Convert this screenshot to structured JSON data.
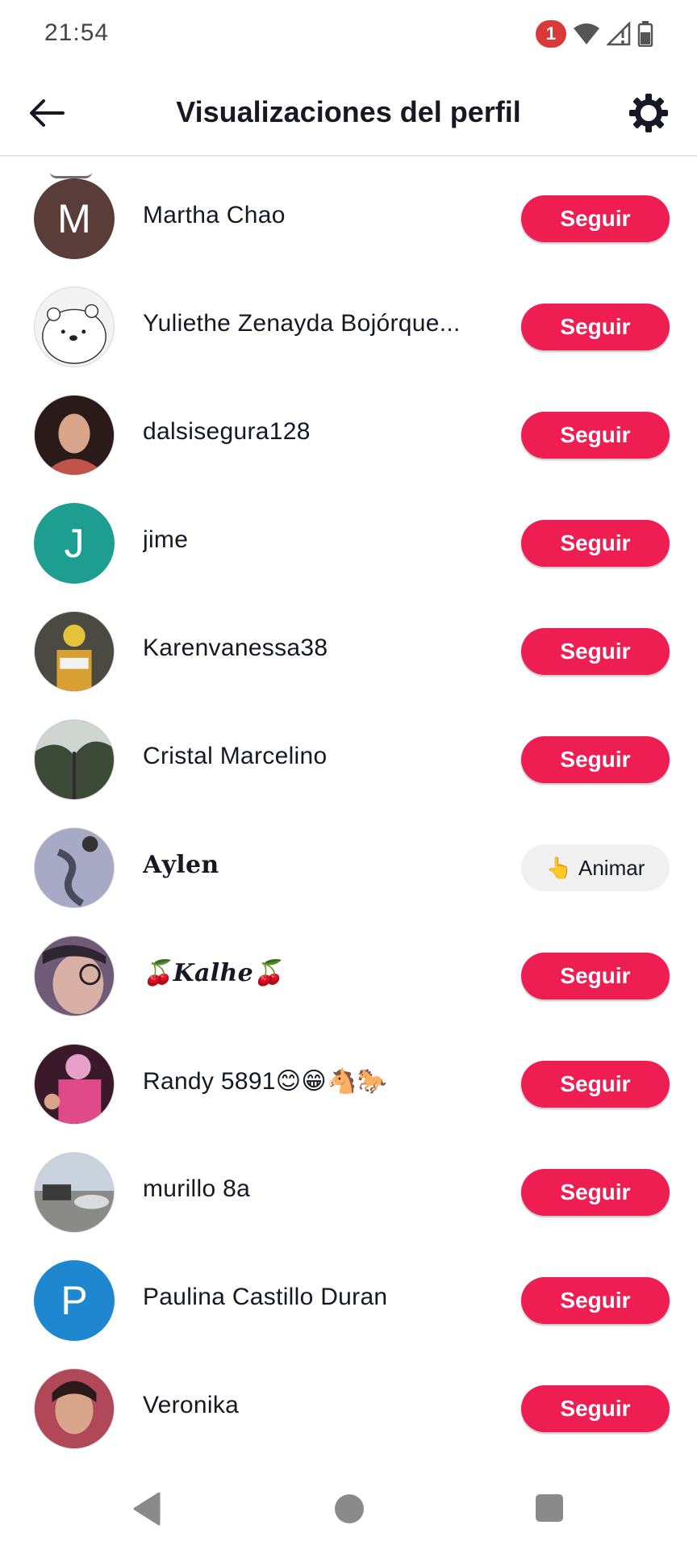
{
  "status_bar": {
    "time": "21:54",
    "notification_count": "1",
    "icons": [
      "wifi-icon",
      "signal-icon",
      "battery-icon"
    ]
  },
  "header": {
    "title": "Visualizaciones del perfil",
    "back_icon": "arrow-left-icon",
    "settings_icon": "gear-icon"
  },
  "colors": {
    "accent": "#ee1d52",
    "cheer_bg": "#f1f1f2"
  },
  "rows": [
    {
      "name": "Martha Chao",
      "avatar_letter": "M",
      "avatar_color": "#5a3c39",
      "action": "Seguir"
    },
    {
      "name": "Yuliethe Zenayda Bojórque...",
      "avatar_letter": "",
      "avatar_color": "#f3f3f3",
      "action": "Seguir"
    },
    {
      "name": "dalsisegura128",
      "avatar_letter": "",
      "avatar_color": "#6b3b3a",
      "action": "Seguir"
    },
    {
      "name": "jime",
      "avatar_letter": "J",
      "avatar_color": "#1e9e90",
      "action": "Seguir"
    },
    {
      "name": "Karenvanessa38",
      "avatar_letter": "",
      "avatar_color": "#7a6a4a",
      "action": "Seguir"
    },
    {
      "name": "Cristal Marcelino",
      "avatar_letter": "",
      "avatar_color": "#5d6b5a",
      "action": "Seguir"
    },
    {
      "name": "𝐀𝐲𝐥𝐞𝐧",
      "avatar_letter": "",
      "avatar_color": "#8c8fae",
      "action": "Animar",
      "action_icon": "👆"
    },
    {
      "name": "🍒𝑲𝒂𝒍𝒉𝒆🍒",
      "avatar_letter": "",
      "avatar_color": "#8a6a88",
      "action": "Seguir"
    },
    {
      "name": "Randy 5891😊😁🐴🐎",
      "avatar_letter": "",
      "avatar_color": "#b03060",
      "action": "Seguir"
    },
    {
      "name": "murillo 8a",
      "avatar_letter": "",
      "avatar_color": "#9aa3ad",
      "action": "Seguir"
    },
    {
      "name": "Paulina Castillo Duran",
      "avatar_letter": "P",
      "avatar_color": "#1f86d0",
      "action": "Seguir"
    },
    {
      "name": "Veronika",
      "avatar_letter": "",
      "avatar_color": "#b0485a",
      "action": "Seguir"
    }
  ],
  "nav": {
    "back": "nav-back-icon",
    "home": "nav-home-icon",
    "recent": "nav-recent-icon"
  }
}
